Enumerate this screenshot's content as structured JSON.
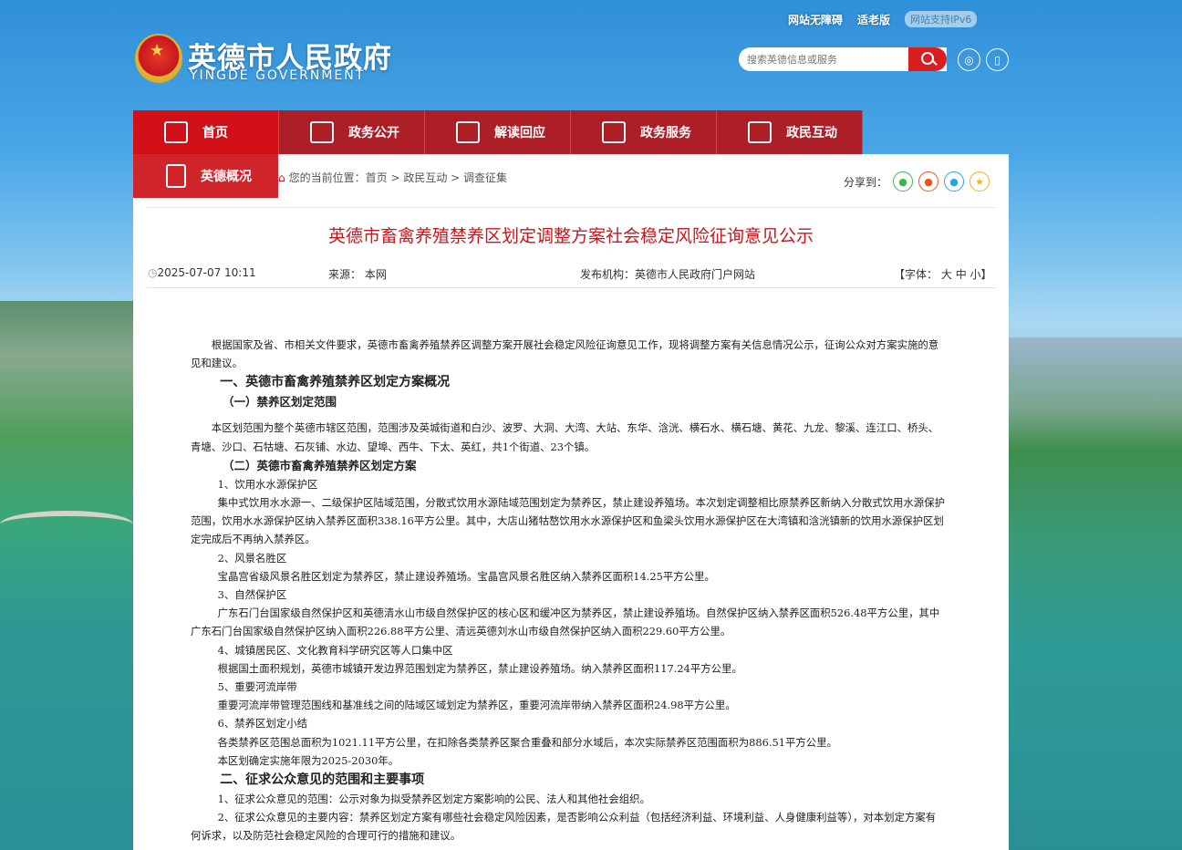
{
  "top_links": {
    "accessible": "网站无障碍",
    "elderly": "适老版",
    "ipv6": "网站支持IPv6"
  },
  "logo": {
    "cn": "英德市人民政府",
    "en": "YINGDE GOVERNMENT"
  },
  "search": {
    "placeholder": "搜索英德信息或服务"
  },
  "nav": {
    "items": [
      {
        "label": "首页"
      },
      {
        "label": "政务公开"
      },
      {
        "label": "解读回应"
      },
      {
        "label": "政务服务"
      },
      {
        "label": "政民互动"
      }
    ],
    "sub": "英德概况"
  },
  "breadcrumb": {
    "prefix": "您的当前位置：",
    "home": "首页",
    "level1": "政民互动",
    "level2": "调查征集"
  },
  "share": {
    "label": "分享到："
  },
  "article": {
    "title": "英德市畜禽养殖禁养区划定调整方案社会稳定风险征询意见公示",
    "date": "2025-07-07 10:11",
    "source": "来源： 本网",
    "publisher": "发布机构：英德市人民政府门户网站",
    "font_label": "【字体：",
    "font_large": "大",
    "font_mid": "中",
    "font_small": "小】",
    "paragraphs": [
      "根据国家及省、市相关文件要求，英德市畜禽养殖禁养区调整方案开展社会稳定风险征询意见工作，现将调整方案有关信息情况公示，征询公众对方案实施的意见和建议。",
      "一、英德市畜禽养殖禁养区划定方案概况",
      "（一）禁养区划定范围",
      "本区划范围为整个英德市辖区范围，范围涉及英城街道和白沙、波罗、大洞、大湾、大站、东华、浛洸、横石水、横石塘、黄花、九龙、黎溪、连江口、桥头、青塘、沙口、石牯塘、石灰铺、水边、望埠、西牛、下太、英红，共1个街道、23个镇。",
      "（二）英德市畜禽养殖禁养区划定方案",
      "1、饮用水水源保护区",
      "集中式饮用水水源一、二级保护区陆域范围，分散式饮用水源陆域范围划定为禁养区，禁止建设养殖场。本次划定调整相比原禁养区新纳入分散式饮用水源保护范围，饮用水水源保护区纳入禁养区面积338.16平方公里。其中，大店山猪牯嶅饮用水水源保护区和鱼梁头饮用水源保护区在大湾镇和浛洸镇新的饮用水源保护区划定完成后不再纳入禁养区。",
      "2、风景名胜区",
      "宝晶宫省级风景名胜区划定为禁养区，禁止建设养殖场。宝晶宫风景名胜区纳入禁养区面积14.25平方公里。",
      "3、自然保护区",
      "广东石门台国家级自然保护区和英德清水山市级自然保护区的核心区和缓冲区为禁养区，禁止建设养殖场。自然保护区纳入禁养区面积526.48平方公里，其中广东石门台国家级自然保护区纳入面积226.88平方公里、清远英德刘水山市级自然保护区纳入面积229.60平方公里。",
      "4、城镇居民区、文化教育科学研究区等人口集中区",
      "根据国土面积规划，英德市城镇开发边界范围划定为禁养区，禁止建设养殖场。纳入禁养区面积117.24平方公里。",
      "5、重要河流岸带",
      "重要河流岸带管理范围线和基准线之间的陆域区域划定为禁养区，重要河流岸带纳入禁养区面积24.98平方公里。",
      "6、禁养区划定小结",
      "各类禁养区范围总面积为1021.11平方公里，在扣除各类禁养区聚合重叠和部分水域后，本次实际禁养区范围面积为886.51平方公里。",
      "本区划确定实施年限为2025-2030年。",
      "二、征求公众意见的范围和主要事项",
      "1、征求公众意见的范围：公示对象为拟受禁养区划定方案影响的公民、法人和其他社会组织。",
      "2、征求公众意见的主要内容：禁养区划定方案有哪些社会稳定风险因素，是否影响公众利益（包括经济利益、环境利益、人身健康利益等），对本划定方案有何诉求，以及防范社会稳定风险的合理可行的措施和建议。"
    ]
  }
}
